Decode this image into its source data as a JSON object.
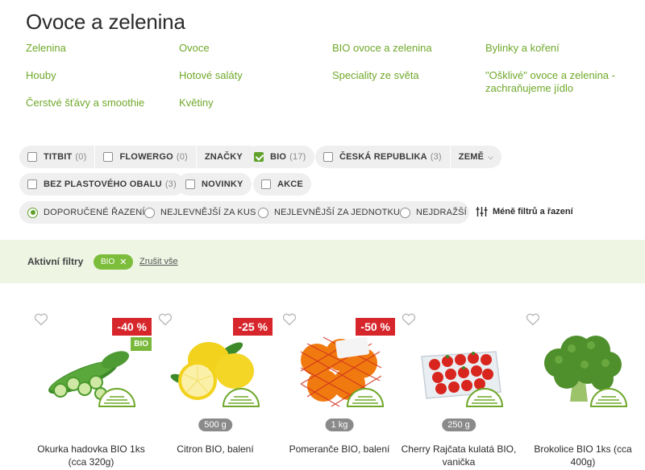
{
  "page_title": "Ovoce a zelenina",
  "categories": [
    "Zelenina",
    "Ovoce",
    "BIO ovoce a zelenina",
    "Bylinky a koření",
    "Houby",
    "Hotové saláty",
    "Speciality ze světa",
    "\"Ošklivé\" ovoce a zelenina - zachraňujeme jídlo",
    "Čerstvé šťávy a smoothie",
    "Květiny"
  ],
  "filters": {
    "titbit": {
      "label": "TITBIT",
      "count": "(0)"
    },
    "flowergo": {
      "label": "FLOWERGO",
      "count": "(0)"
    },
    "brands": {
      "label": "ZNAČKY"
    },
    "bio": {
      "label": "BIO",
      "count": "(17)"
    },
    "czech": {
      "label": "ČESKÁ REPUBLIKA",
      "count": "(3)"
    },
    "country": {
      "label": "ZEMĚ"
    },
    "no_plastic": {
      "label": "BEZ PLASTOVÉHO OBALU",
      "count": "(3)"
    },
    "new": {
      "label": "NOVINKY"
    },
    "sale": {
      "label": "AKCE"
    }
  },
  "sort": {
    "options": [
      "DOPORUČENÉ ŘAZENÍ",
      "NEJLEVNĚJŠÍ ZA KUS",
      "NEJLEVNĚJŠÍ ZA JEDNOTKU",
      "NEJDRAŽŠÍ"
    ],
    "selected": "DOPORUČENÉ ŘAZENÍ",
    "less_filters_label": "Méně filtrů a řazení"
  },
  "active_filters": {
    "label": "Aktivní filtry",
    "chips": [
      "BIO"
    ],
    "clear_label": "Zrušit vše"
  },
  "products": [
    {
      "name": "Okurka hadovka BIO 1ks (cca 320g)",
      "discount": "-40 %",
      "badge": "BIO",
      "weight": ""
    },
    {
      "name": "Citron BIO, balení",
      "discount": "-25 %",
      "badge": "",
      "weight": "500 g"
    },
    {
      "name": "Pomeranče BIO, balení",
      "discount": "-50 %",
      "badge": "",
      "weight": "1 kg"
    },
    {
      "name": "Cherry Rajčata kulatá BIO, vanička",
      "discount": "",
      "badge": "",
      "weight": "250 g"
    },
    {
      "name": "Brokolice BIO 1ks (cca 400g)",
      "discount": "",
      "badge": "",
      "weight": ""
    }
  ],
  "colors": {
    "accent_green": "#6fa82a",
    "discount_red": "#d7262b",
    "active_band": "#eef5e3"
  }
}
